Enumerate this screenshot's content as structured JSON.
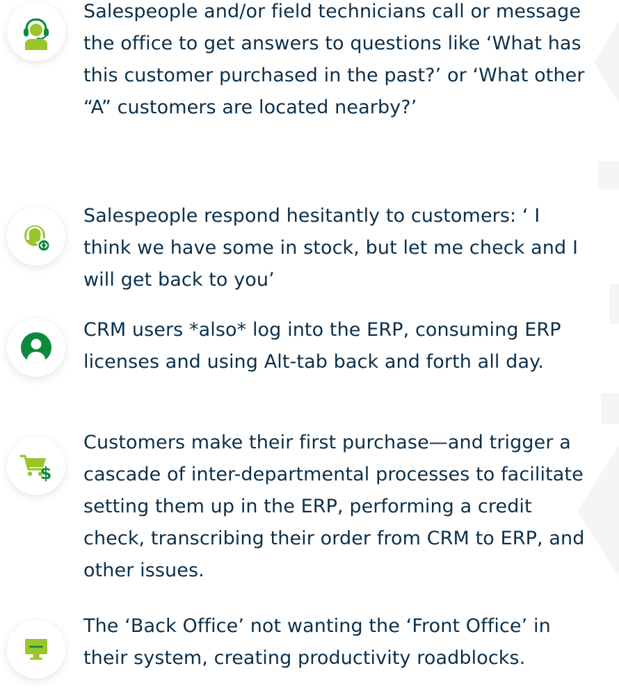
{
  "colors": {
    "text": "#0b2f4a",
    "accent_lime": "#9bc52c",
    "accent_green": "#0d8a3c",
    "icon_shadow": "rgba(0,0,0,0.11)"
  },
  "items": [
    {
      "icon": "headset-agent-icon",
      "text": "Salespeople and/or field technicians call or message the office to get answers to questions like ‘What has this customer purchased in the past?’ or ‘What other “A” customers are located nearby?’"
    },
    {
      "icon": "headset-code-icon",
      "text": "Salespeople respond hesitantly to customers: ‘ I think we have some in stock, but let me check and I will get back to you’"
    },
    {
      "icon": "user-profile-icon",
      "text": "CRM users *also* log into the ERP, consuming ERP licenses and using Alt-tab back and forth all day."
    },
    {
      "icon": "cart-dollar-icon",
      "text": "Customers make their first purchase—and trigger a cascade of inter-departmental processes to facilitate setting them up in the ERP, performing a credit check, transcribing their order from CRM to ERP, and other issues."
    },
    {
      "icon": "monitor-icon",
      "text": "The ‘Back Office’ not wanting the ‘Front Office’ in their system, creating productivity roadblocks."
    }
  ]
}
